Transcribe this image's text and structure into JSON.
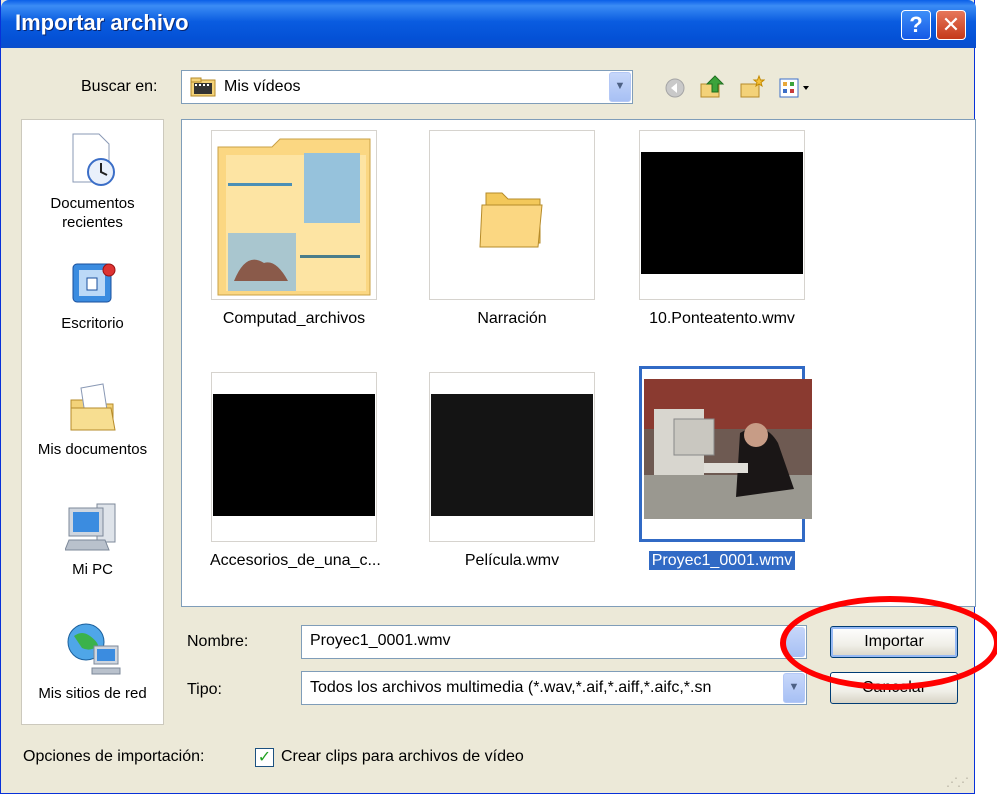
{
  "dialog": {
    "title": "Importar archivo",
    "help_glyph": "?",
    "close_glyph": "✕"
  },
  "toolbar": {
    "look_in_label": "Buscar en:",
    "look_in_value": "Mis vídeos"
  },
  "places": [
    {
      "label": "Documentos recientes",
      "icon": "recent-documents-icon"
    },
    {
      "label": "Escritorio",
      "icon": "desktop-icon"
    },
    {
      "label": "Mis documentos",
      "icon": "my-documents-icon"
    },
    {
      "label": "Mi PC",
      "icon": "my-computer-icon"
    },
    {
      "label": "Mis sitios de red",
      "icon": "network-places-icon"
    }
  ],
  "files": [
    {
      "name": "Computad_archivos",
      "kind": "folder-with-preview"
    },
    {
      "name": "Narración",
      "kind": "folder"
    },
    {
      "name": "10.Ponteatento.wmv",
      "kind": "video"
    },
    {
      "name": "Accesorios_de_una_c...",
      "kind": "video"
    },
    {
      "name": "Película.wmv",
      "kind": "video"
    },
    {
      "name": "Proyec1_0001.wmv",
      "kind": "video-selected"
    }
  ],
  "form": {
    "name_label": "Nombre:",
    "name_value": "Proyec1_0001.wmv",
    "type_label": "Tipo:",
    "type_value": "Todos los archivos multimedia (*.wav,*.aif,*.aiff,*.aifc,*.sn",
    "import_button": "Importar",
    "cancel_button": "Cancelar"
  },
  "options": {
    "label": "Opciones de importación:",
    "checkbox_label": "Crear clips para archivos de vídeo",
    "checkbox_checked": true
  },
  "colors": {
    "title_bar": "#0451d6",
    "selection": "#316ac5",
    "annotation_circle": "#ff0000"
  }
}
